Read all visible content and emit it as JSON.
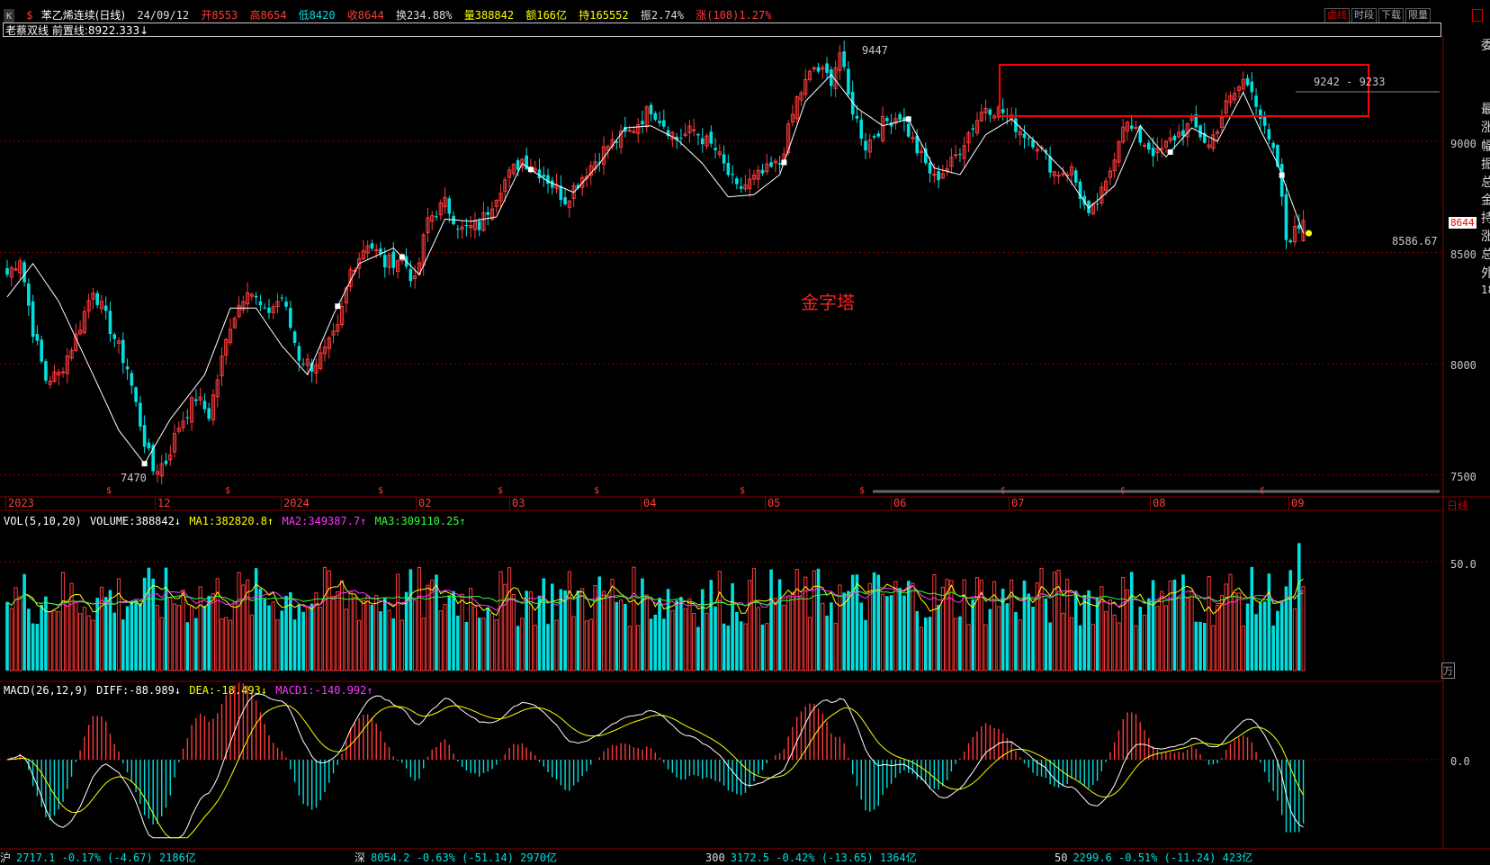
{
  "header": {
    "icon": "K",
    "dollar": "$",
    "title": "苯乙烯连续(日线)",
    "date": "24/09/12",
    "open": "开8553",
    "high": "高8654",
    "low": "低8420",
    "close": "收8644",
    "turnover": "换234.88%",
    "volume": "量388842",
    "amount": "额166亿",
    "position": "持165552",
    "amplitude": "振2.74%",
    "change": "涨(108)1.27%",
    "buttons": [
      "虚线",
      "时段",
      "下载",
      "限量"
    ]
  },
  "indicator_line": "老蔡双线  前置线:8922.333↓",
  "colors": {
    "up": "#ff3a3a",
    "down": "#00e0e0",
    "ma": "#ffffff",
    "ma1": "#ffffff",
    "ma2": "#ff33ff",
    "ma3": "#33ff33",
    "dea": "#ffff00",
    "grid": "#8b0000",
    "accent": "#ff0000",
    "yellow": "#ffff00"
  },
  "price_axis": {
    "ticks": [
      "9000",
      "8500",
      "8000",
      "7500"
    ],
    "current": "8644",
    "unit": "万"
  },
  "annotations": {
    "high": "9447",
    "low": "7470",
    "range": "9242 - 9233",
    "end_value": "8586.67",
    "pattern": "金字塔"
  },
  "months": [
    "2023",
    "12",
    "2024",
    "02",
    "03",
    "04",
    "05",
    "06",
    "07",
    "08",
    "09"
  ],
  "months_right_label": "日线",
  "vol": {
    "label": "VOL(5,10,20)",
    "volume": "VOLUME:388842↓",
    "ma1": "MA1:382820.8↑",
    "ma2": "MA2:349387.7↑",
    "ma3": "MA3:309110.25↑",
    "tick": "50.0",
    "unit": "万"
  },
  "macd": {
    "label": "MACD(26,12,9)",
    "diff": "DIFF:-88.989↓",
    "dea": "DEA:-18.493↓",
    "macd": "MACD1:-140.992↑",
    "zero": "0.0"
  },
  "side_labels": [
    "委",
    "最",
    "涨",
    "幅",
    "振",
    "总",
    "金",
    "持",
    "涨",
    "总",
    "外",
    "18"
  ],
  "footer": [
    {
      "name": "沪",
      "text": "2717.1 -0.17% (-4.67) 2186亿"
    },
    {
      "name": "深",
      "text": "8054.2 -0.63% (-51.14) 2970亿"
    },
    {
      "name": "300",
      "text": "3172.5 -0.42% (-13.65) 1364亿"
    },
    {
      "name": "50",
      "text": "2299.6 -0.51% (-11.24) 423亿"
    }
  ],
  "chart_data": {
    "type": "candlestick",
    "title": "苯乙烯连续(日线)",
    "y_range": [
      7450,
      9600
    ],
    "grid_lines": [
      9000,
      8500,
      8000,
      7500
    ],
    "anchors": [
      [
        0,
        8400
      ],
      [
        3,
        8480
      ],
      [
        6,
        8150
      ],
      [
        9,
        7930
      ],
      [
        12,
        7950
      ],
      [
        16,
        8120
      ],
      [
        20,
        8340
      ],
      [
        24,
        8160
      ],
      [
        28,
        7980
      ],
      [
        32,
        7650
      ],
      [
        34,
        7520
      ],
      [
        37,
        7560
      ],
      [
        40,
        7720
      ],
      [
        44,
        7850
      ],
      [
        47,
        7770
      ],
      [
        52,
        8180
      ],
      [
        56,
        8350
      ],
      [
        60,
        8220
      ],
      [
        64,
        8300
      ],
      [
        68,
        8030
      ],
      [
        71,
        7990
      ],
      [
        74,
        8050
      ],
      [
        77,
        8150
      ],
      [
        80,
        8420
      ],
      [
        84,
        8550
      ],
      [
        88,
        8450
      ],
      [
        92,
        8480
      ],
      [
        95,
        8360
      ],
      [
        98,
        8650
      ],
      [
        102,
        8720
      ],
      [
        106,
        8600
      ],
      [
        110,
        8620
      ],
      [
        115,
        8800
      ],
      [
        120,
        8920
      ],
      [
        125,
        8850
      ],
      [
        130,
        8740
      ],
      [
        135,
        8870
      ],
      [
        140,
        8980
      ],
      [
        145,
        9040
      ],
      [
        150,
        9150
      ],
      [
        156,
        9010
      ],
      [
        160,
        9050
      ],
      [
        165,
        8960
      ],
      [
        170,
        8780
      ],
      [
        175,
        8840
      ],
      [
        180,
        8900
      ],
      [
        184,
        9190
      ],
      [
        188,
        9330
      ],
      [
        192,
        9280
      ],
      [
        194,
        9400
      ],
      [
        196,
        9200
      ],
      [
        200,
        8980
      ],
      [
        204,
        9080
      ],
      [
        208,
        9120
      ],
      [
        212,
        8960
      ],
      [
        216,
        8830
      ],
      [
        220,
        8900
      ],
      [
        224,
        9040
      ],
      [
        228,
        9160
      ],
      [
        232,
        9130
      ],
      [
        236,
        9050
      ],
      [
        240,
        8990
      ],
      [
        244,
        8860
      ],
      [
        248,
        8870
      ],
      [
        252,
        8650
      ],
      [
        256,
        8800
      ],
      [
        260,
        9090
      ],
      [
        264,
        9010
      ],
      [
        268,
        8940
      ],
      [
        272,
        9020
      ],
      [
        276,
        9080
      ],
      [
        280,
        8980
      ],
      [
        284,
        9160
      ],
      [
        288,
        9270
      ],
      [
        290,
        9250
      ],
      [
        293,
        9040
      ],
      [
        296,
        8890
      ],
      [
        298,
        8560
      ],
      [
        300,
        8590
      ],
      [
        302,
        8644
      ]
    ],
    "ma_anchors": [
      [
        0,
        8300
      ],
      [
        6,
        8450
      ],
      [
        12,
        8280
      ],
      [
        20,
        7950
      ],
      [
        26,
        7700
      ],
      [
        32,
        7550
      ],
      [
        38,
        7750
      ],
      [
        46,
        7950
      ],
      [
        52,
        8250
      ],
      [
        58,
        8250
      ],
      [
        64,
        8080
      ],
      [
        70,
        7950
      ],
      [
        76,
        8220
      ],
      [
        82,
        8450
      ],
      [
        90,
        8520
      ],
      [
        96,
        8400
      ],
      [
        102,
        8650
      ],
      [
        108,
        8640
      ],
      [
        114,
        8660
      ],
      [
        120,
        8900
      ],
      [
        126,
        8820
      ],
      [
        132,
        8770
      ],
      [
        138,
        8900
      ],
      [
        144,
        9060
      ],
      [
        150,
        9070
      ],
      [
        156,
        9010
      ],
      [
        162,
        8900
      ],
      [
        168,
        8750
      ],
      [
        174,
        8760
      ],
      [
        180,
        8850
      ],
      [
        186,
        9180
      ],
      [
        192,
        9300
      ],
      [
        198,
        9150
      ],
      [
        204,
        9070
      ],
      [
        210,
        9100
      ],
      [
        216,
        8880
      ],
      [
        222,
        8850
      ],
      [
        228,
        9030
      ],
      [
        234,
        9100
      ],
      [
        240,
        8990
      ],
      [
        246,
        8870
      ],
      [
        252,
        8700
      ],
      [
        258,
        8800
      ],
      [
        264,
        9070
      ],
      [
        270,
        8930
      ],
      [
        276,
        9060
      ],
      [
        282,
        9000
      ],
      [
        288,
        9220
      ],
      [
        292,
        9050
      ],
      [
        296,
        8900
      ],
      [
        302,
        8586.67
      ]
    ],
    "volume_range": [
      0,
      650000
    ],
    "macd_range": [
      -170,
      150
    ]
  }
}
